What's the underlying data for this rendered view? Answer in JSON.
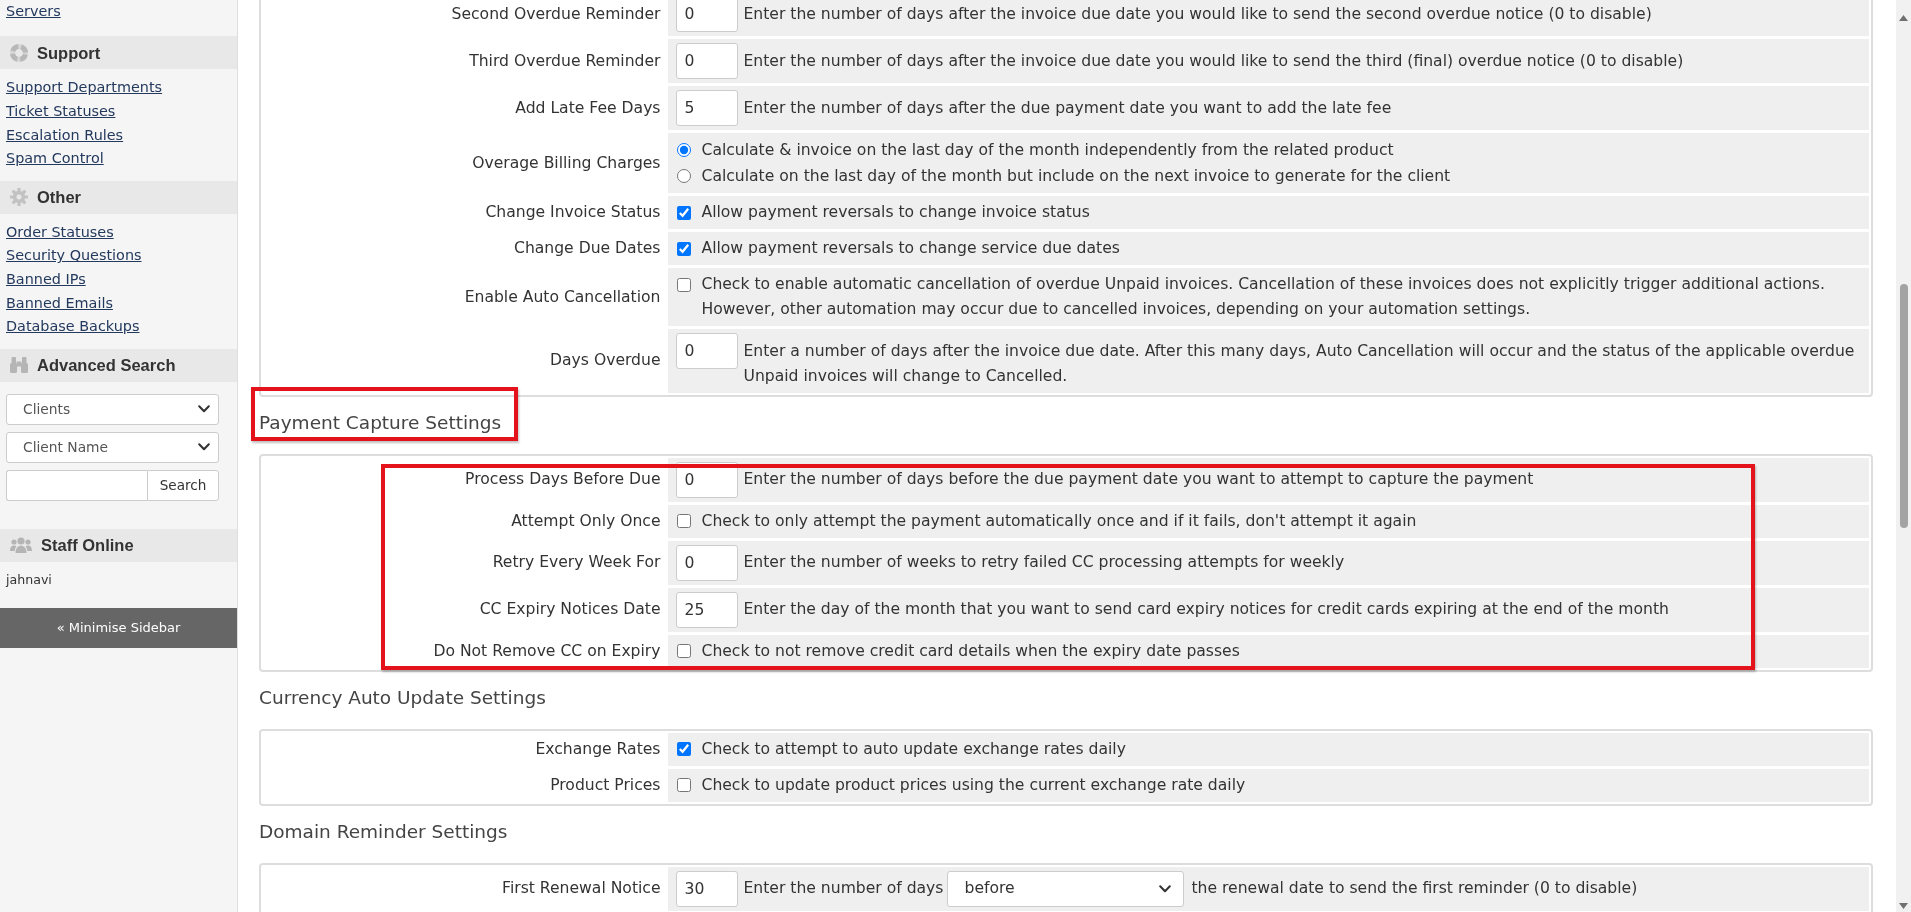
{
  "sidebar": {
    "cut_links": [
      "Servers"
    ],
    "panels": [
      {
        "kind": "links",
        "title": "Support",
        "links": [
          "Support Departments",
          "Ticket Statuses",
          "Escalation Rules",
          "Spam Control"
        ]
      },
      {
        "kind": "links",
        "title": "Other",
        "links": [
          "Order Statuses",
          "Security Questions",
          "Banned IPs",
          "Banned Emails",
          "Database Backups"
        ]
      },
      {
        "kind": "search",
        "title": "Advanced Search",
        "selects": [
          "Clients",
          "Client Name"
        ],
        "button": "Search"
      },
      {
        "kind": "staff",
        "title": "Staff Online",
        "staff": [
          "jahnavi"
        ]
      }
    ],
    "minimise_button": "« Minimise Sidebar"
  },
  "sections": [
    {
      "rows_highlighted": false,
      "rows": [
        {
          "kind": "number",
          "label": "Second Overdue Reminder",
          "value": "0",
          "description": "Enter the number of days after the invoice due date you would like to send the second overdue notice (0 to disable)"
        },
        {
          "kind": "number",
          "label": "Third Overdue Reminder",
          "value": "0",
          "description": "Enter the number of days after the invoice due date you would like to send the third (final) overdue notice (0 to disable)"
        },
        {
          "kind": "number",
          "label": "Add Late Fee Days",
          "value": "5",
          "description": "Enter the number of days after the due payment date you want to add the late fee"
        },
        {
          "kind": "radio",
          "label": "Overage Billing Charges",
          "options": [
            {
              "text": "Calculate & invoice on the last day of the month independently from the related product",
              "selected": true
            },
            {
              "text": "Calculate on the last day of the month but include on the next invoice to generate for the client",
              "selected": false
            }
          ]
        },
        {
          "kind": "checkbox",
          "label": "Change Invoice Status",
          "checked": true,
          "description": "Allow payment reversals to change invoice status"
        },
        {
          "kind": "checkbox",
          "label": "Change Due Dates",
          "checked": true,
          "description": "Allow payment reversals to change service due dates"
        },
        {
          "kind": "checkbox",
          "label": "Enable Auto Cancellation",
          "checked": false,
          "description": "Check to enable automatic cancellation of overdue Unpaid invoices. Cancellation of these invoices does not explicitly trigger additional actions. However, other automation may occur due to cancelled invoices, depending on your automation settings."
        },
        {
          "kind": "number",
          "label": "Days Overdue",
          "value": "0",
          "description": "Enter a number of days after the invoice due date. After this many days, Auto Cancellation will occur and the status of the applicable overdue Unpaid invoices will change to Cancelled."
        }
      ]
    },
    {
      "title": "Payment Capture Settings",
      "title_highlighted": true,
      "rows_highlighted": true,
      "rows": [
        {
          "kind": "number",
          "label": "Process Days Before Due",
          "value": "0",
          "description": "Enter the number of days before the due payment date you want to attempt to capture the payment"
        },
        {
          "kind": "checkbox",
          "label": "Attempt Only Once",
          "checked": false,
          "description": "Check to only attempt the payment automatically once and if it fails, don't attempt it again"
        },
        {
          "kind": "number",
          "label": "Retry Every Week For",
          "value": "0",
          "description": "Enter the number of weeks to retry failed CC processing attempts for weekly"
        },
        {
          "kind": "number",
          "label": "CC Expiry Notices Date",
          "value": "25",
          "description": "Enter the day of the month that you want to send card expiry notices for credit cards expiring at the end of the month"
        },
        {
          "kind": "checkbox",
          "label": "Do Not Remove CC on Expiry",
          "checked": false,
          "description": "Check to not remove credit card details when the expiry date passes"
        }
      ]
    },
    {
      "title": "Currency Auto Update Settings",
      "title_highlighted": false,
      "rows_highlighted": false,
      "rows": [
        {
          "kind": "checkbox",
          "label": "Exchange Rates",
          "checked": true,
          "description": "Check to attempt to auto update exchange rates daily"
        },
        {
          "kind": "checkbox",
          "label": "Product Prices",
          "checked": false,
          "description": "Check to update product prices using the current exchange rate daily"
        }
      ]
    },
    {
      "title": "Domain Reminder Settings",
      "title_highlighted": false,
      "rows_highlighted": false,
      "rows": [
        {
          "kind": "number_select",
          "label": "First Renewal Notice",
          "value": "30",
          "description": "Enter the number of days",
          "select": "before",
          "suffix": "the renewal date to send the first reminder (0 to disable)"
        }
      ]
    }
  ]
}
